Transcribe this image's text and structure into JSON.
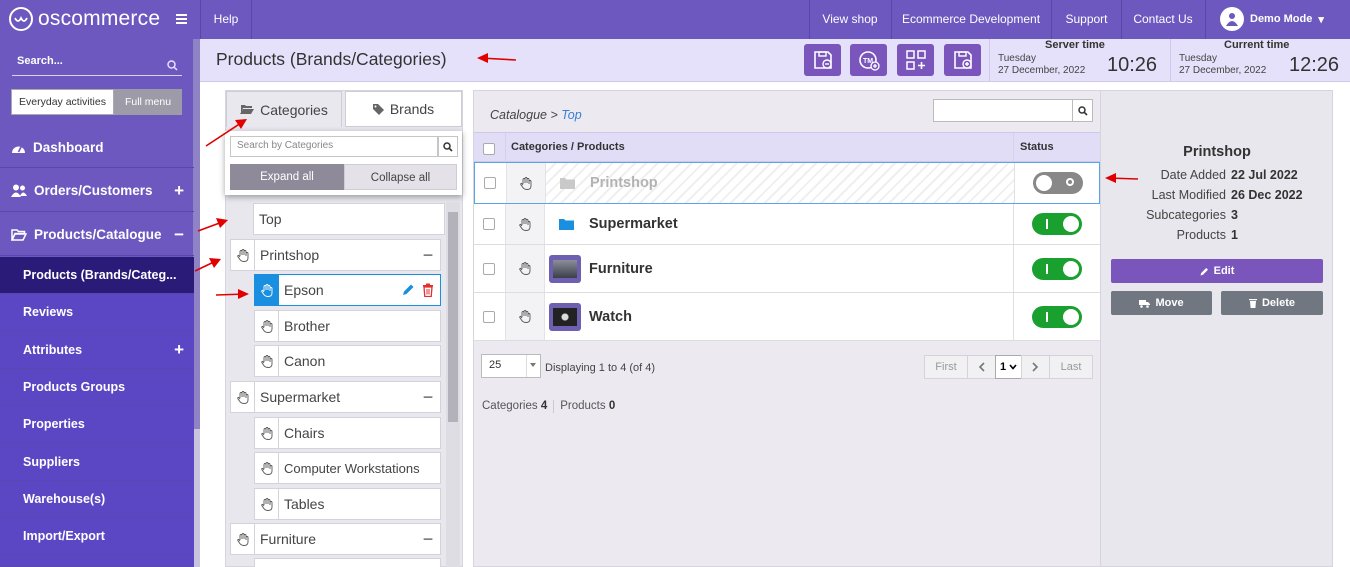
{
  "topbar": {
    "logo_text": "oscommerce",
    "help": "Help",
    "links": [
      "View shop",
      "Ecommerce Development",
      "Support",
      "Contact Us"
    ],
    "user": "Demo Mode"
  },
  "sidebar": {
    "search_placeholder": "Search...",
    "everyday_label": "Everyday activities",
    "fullmenu_label": "Full menu",
    "items": [
      {
        "label": "Dashboard",
        "icon": "dashboard-icon"
      },
      {
        "label": "Orders/Customers",
        "icon": "users-icon"
      },
      {
        "label": "Products/Catalogue",
        "icon": "folder-open-icon"
      }
    ],
    "subitems": [
      "Products (Brands/Categ...",
      "Reviews",
      "Attributes",
      "Products Groups",
      "Properties",
      "Suppliers",
      "Warehouse(s)",
      "Import/Export"
    ]
  },
  "header": {
    "title": "Products (Brands/Categories)",
    "server_label": "Server time",
    "server_day": "Tuesday",
    "server_date": "27 December, 2022",
    "server_time": "10:26",
    "current_label": "Current time",
    "current_day": "Tuesday",
    "current_date": "27 December, 2022",
    "current_time": "12:26"
  },
  "tree": {
    "tab_categories": "Categories",
    "tab_brands": "Brands",
    "search_placeholder": "Search by Categories",
    "expand_all": "Expand all",
    "collapse_all": "Collapse all",
    "nodes": [
      "Top",
      "Printshop",
      "Epson",
      "Brother",
      "Canon",
      "Supermarket",
      "Chairs",
      "Computer Workstations",
      "Tables",
      "Furniture"
    ]
  },
  "main": {
    "breadcrumb_root": "Catalogue",
    "breadcrumb_sep": ">",
    "breadcrumb_current": "Top",
    "col_name": "Categories / Products",
    "col_status": "Status",
    "rows": [
      {
        "name": "Printshop",
        "status": "off"
      },
      {
        "name": "Supermarket",
        "status": "on"
      },
      {
        "name": "Furniture",
        "status": "on"
      },
      {
        "name": "Watch",
        "status": "on"
      }
    ],
    "per_page": "25",
    "display_info": "Displaying 1 to 4 (of 4)",
    "first": "First",
    "last": "Last",
    "page": "1",
    "categories_label": "Categories",
    "categories_count": "4",
    "products_label": "Products",
    "products_count": "0"
  },
  "info": {
    "title": "Printshop",
    "date_added_label": "Date Added",
    "date_added": "22 Jul 2022",
    "last_modified_label": "Last Modified",
    "last_modified": "26 Dec 2022",
    "subcategories_label": "Subcategories",
    "subcategories": "3",
    "products_label": "Products",
    "products": "1",
    "edit": "Edit",
    "move": "Move",
    "delete": "Delete"
  },
  "colors": {
    "brand": "#6c58bf",
    "active_nav": "#2a1b78",
    "toggle_on": "#1aa02f",
    "edit_button": "#7a55bb",
    "annotation_arrow": "#e00000"
  }
}
